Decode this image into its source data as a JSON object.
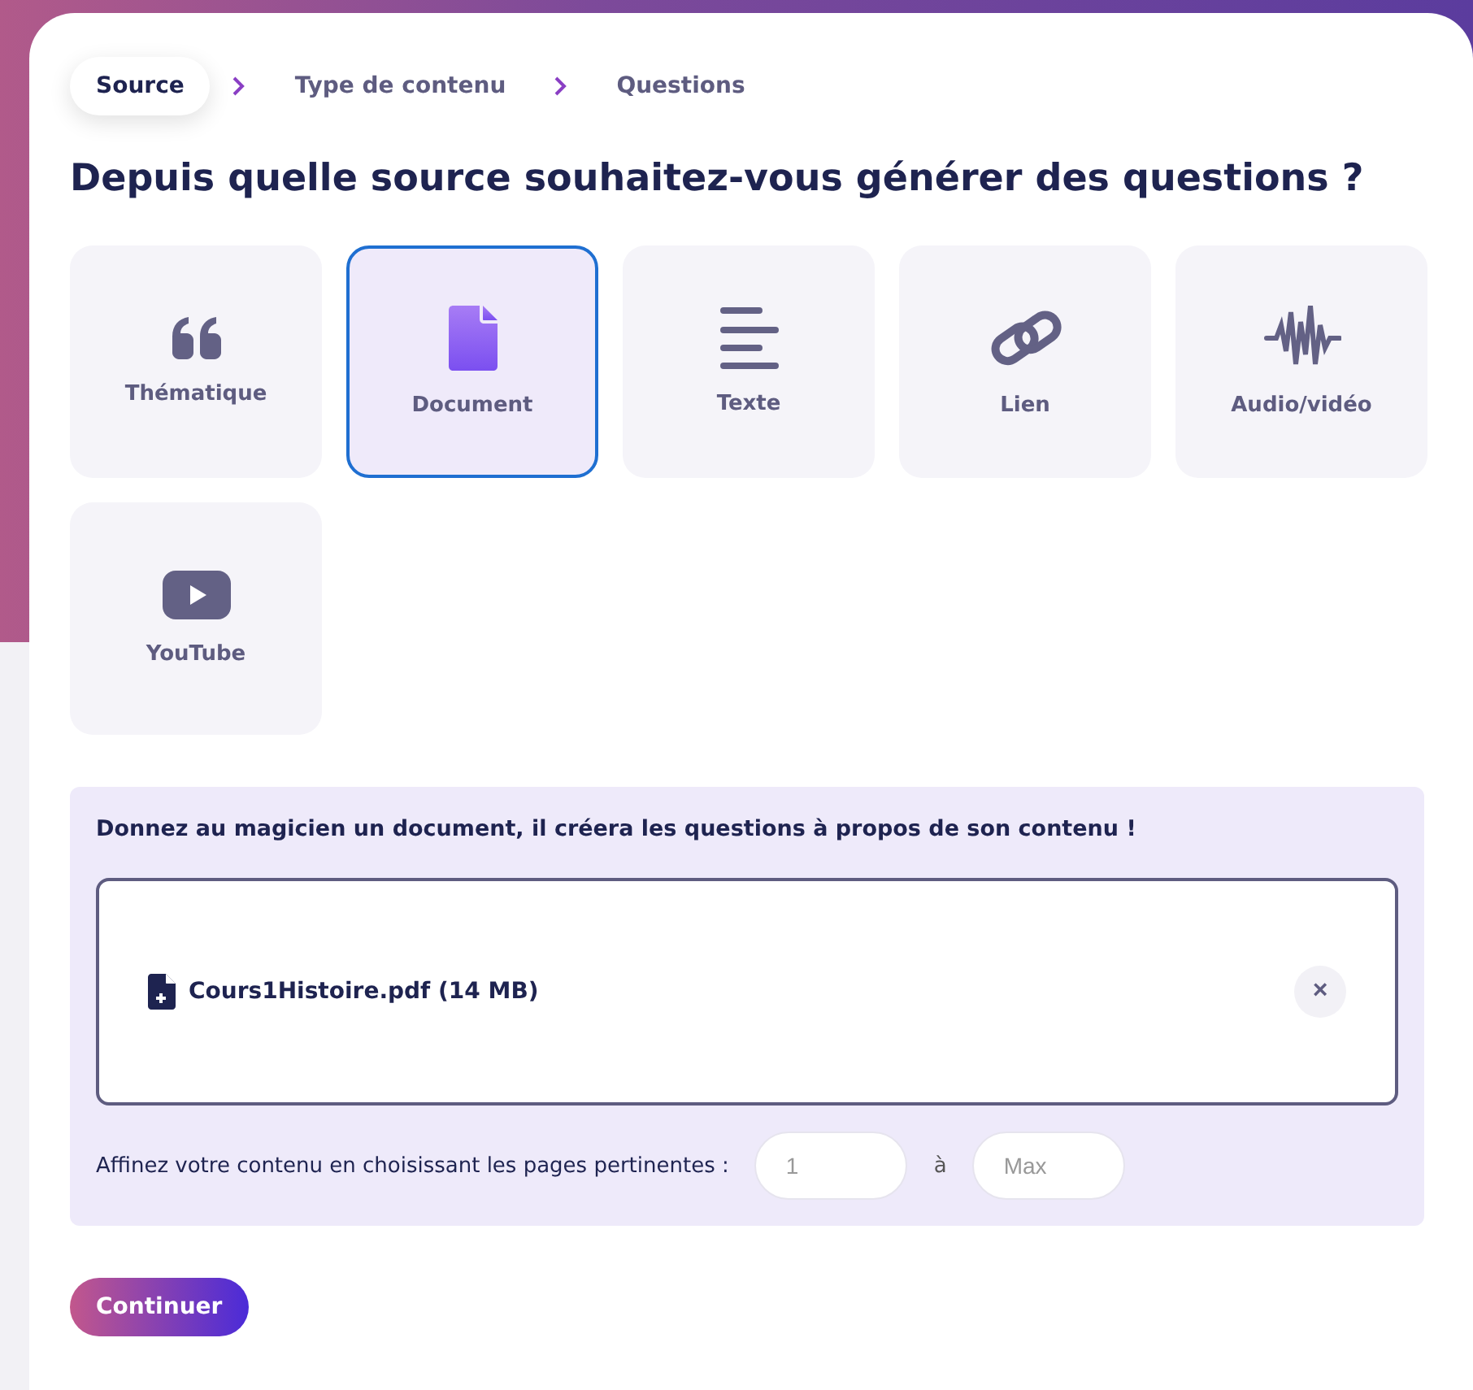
{
  "breadcrumb": [
    {
      "label": "Source",
      "selected": true
    },
    {
      "label": "Type de contenu",
      "selected": false
    },
    {
      "label": "Questions",
      "selected": false
    }
  ],
  "title": "Depuis quelle source souhaitez-vous générer des questions ?",
  "sources": [
    {
      "kind": "quote",
      "label": "Thématique",
      "selected": false
    },
    {
      "kind": "document",
      "label": "Document",
      "selected": true
    },
    {
      "kind": "text",
      "label": "Texte",
      "selected": false
    },
    {
      "kind": "link",
      "label": "Lien",
      "selected": false
    },
    {
      "kind": "audio",
      "label": "Audio/vidéo",
      "selected": false
    },
    {
      "kind": "youtube",
      "label": "YouTube",
      "selected": false
    }
  ],
  "panel": {
    "instruction": "Donnez au magicien un document, il créera les questions à propos de son contenu !",
    "file": "Cours1Histoire.pdf (14 MB)",
    "remove": "×",
    "range_label": "Affinez votre contenu en choisissant les pages pertinentes :",
    "from": {
      "placeholder": "1"
    },
    "separator": "à",
    "to": {
      "placeholder": "Max"
    }
  },
  "continue": "Continuer"
}
